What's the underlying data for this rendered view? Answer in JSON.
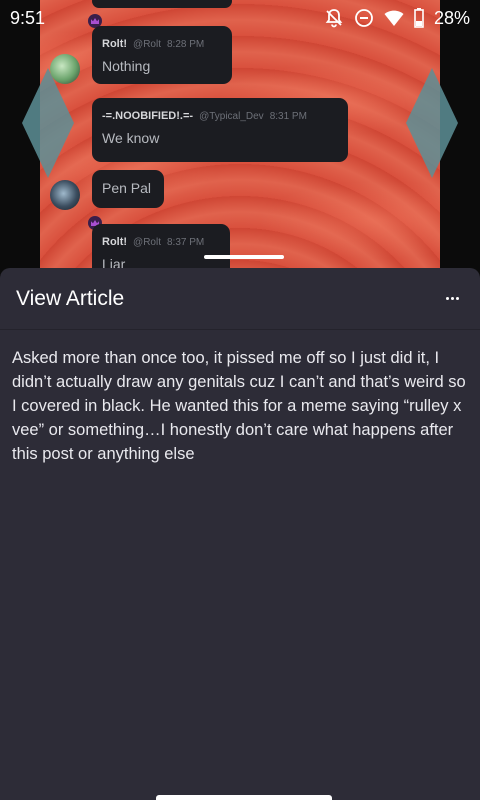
{
  "status_bar": {
    "time": "9:51",
    "battery": "28%",
    "icons": [
      "notifications-off-icon",
      "do-not-disturb-icon",
      "wifi-icon",
      "battery-icon"
    ]
  },
  "chat_preview": {
    "messages": [
      {
        "author": "Rolt!",
        "handle": "@Rolt",
        "time": "8:28 PM",
        "text": "Nothing"
      },
      {
        "author": "-=.NOOBIFIED!.=-",
        "handle": "@Typical_Dev",
        "time": "8:31 PM",
        "text": "We know"
      },
      {
        "author": "",
        "handle": "",
        "time": "",
        "text": "Pen Pal"
      },
      {
        "author": "Rolt!",
        "handle": "@Rolt",
        "time": "8:37 PM",
        "text": "Liar"
      }
    ]
  },
  "sheet": {
    "title": "View Article",
    "more_icon": "more-horizontal-icon",
    "body": "Asked more than once too, it pissed me off so I just did it, I didn’t actually draw any genitals cuz I can’t and that’s weird so I covered in black. He wanted this for a meme saying “rulley x vee” or something…I honestly don’t care what happens after this post or anything else"
  },
  "colors": {
    "sheet_background": "#2d2c37",
    "image_background": "#d9503d",
    "bubble_background": "#1b1c21",
    "text_primary": "#ffffff"
  }
}
